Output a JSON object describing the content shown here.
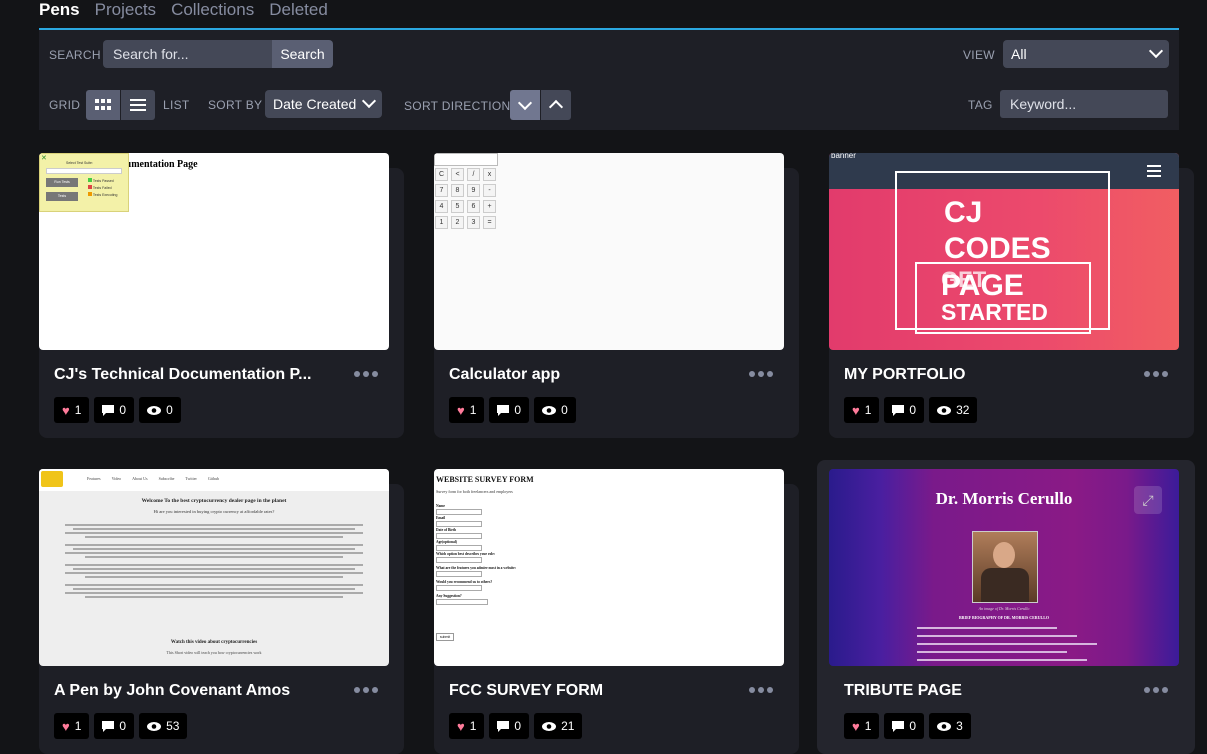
{
  "tabs": [
    "Pens",
    "Projects",
    "Collections",
    "Deleted"
  ],
  "filters": {
    "search_label": "SEARCH",
    "search_placeholder": "Search for...",
    "search_button": "Search",
    "view_label": "VIEW",
    "view_value": "All",
    "grid_label": "GRID",
    "list_label": "LIST",
    "sort_by_label": "SORT BY",
    "sort_by_value": "Date Created",
    "sort_direction_label": "SORT DIRECTION",
    "tag_label": "TAG",
    "tag_placeholder": "Keyword..."
  },
  "pens": [
    {
      "title": "CJ's Technical Documentation P...",
      "likes": "1",
      "comments": "0",
      "views": "0",
      "preview": {
        "heading": "Documentation Page",
        "tooltip": [
          "Select Test Suite:",
          "Run Tests",
          "Tests",
          "Tests Passed",
          "Tests Failed",
          "Tests Executing"
        ]
      }
    },
    {
      "title": "Calculator app",
      "likes": "1",
      "comments": "0",
      "views": "0",
      "preview": {
        "keys": [
          "C",
          "<",
          "/",
          "x",
          "7",
          "8",
          "9",
          "-",
          "4",
          "5",
          "6",
          "+",
          "1",
          "2",
          "3",
          "="
        ]
      }
    },
    {
      "title": "MY PORTFOLIO",
      "likes": "1",
      "comments": "0",
      "views": "32",
      "preview": {
        "banner": "banner",
        "headline": [
          "CJ",
          "CODES",
          "PAGE"
        ],
        "button": [
          "GET",
          "STARTED"
        ]
      }
    },
    {
      "title": "A Pen by John Covenant Amos",
      "likes": "1",
      "comments": "0",
      "views": "53",
      "preview": {
        "nav": [
          "Features",
          "Video",
          "About Us",
          "Subscribe",
          "Twitter",
          "Github"
        ],
        "heading": "Welcome To the best cryptocurrency dealer page in the planet",
        "sub": "Hi are you interested in buying crypto currency at affordable rates?",
        "video_heading": "Watch this video about cryptocurrencies",
        "video_sub": "This Short video will teach you how cryptocurrencies work"
      }
    },
    {
      "title": "FCC SURVEY FORM",
      "likes": "1",
      "comments": "0",
      "views": "21",
      "preview": {
        "heading": "WEBSITE SURVEY FORM",
        "sub": "Survey form for both freelancers and employers",
        "fields": [
          "Name",
          "Email",
          "Date of Birth",
          "Age(optional)",
          "Which option best describes your role:",
          "What are the features you admire most in a website:",
          "Would you recommend us to others?",
          "Any Suggestion?"
        ],
        "submit": "submit"
      }
    },
    {
      "title": "TRIBUTE PAGE",
      "likes": "1",
      "comments": "0",
      "views": "3",
      "preview": {
        "heading": "Dr. Morris Cerullo",
        "caption": "An image of Dr. Morris Cerullo",
        "bio_title": "BRIEF BIOGRAPHY OF DR. MORRIS CERULLO"
      }
    }
  ]
}
